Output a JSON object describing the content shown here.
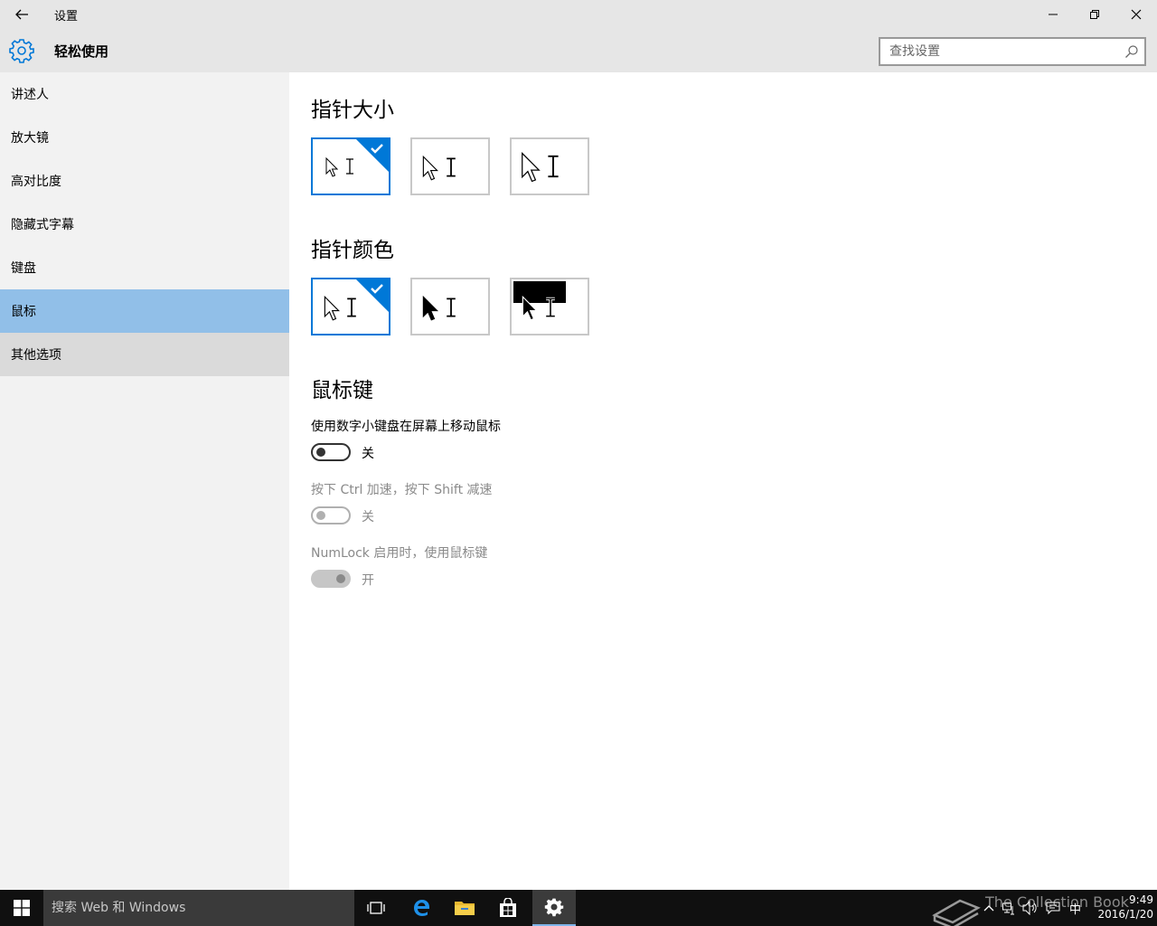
{
  "window": {
    "title": "设置"
  },
  "header": {
    "title": "轻松使用",
    "search_placeholder": "查找设置"
  },
  "sidebar": {
    "items": [
      {
        "label": "讲述人"
      },
      {
        "label": "放大镜"
      },
      {
        "label": "高对比度"
      },
      {
        "label": "隐藏式字幕"
      },
      {
        "label": "键盘"
      },
      {
        "label": "鼠标",
        "selected": true
      },
      {
        "label": "其他选项"
      }
    ]
  },
  "content": {
    "pointer_size": {
      "title": "指针大小",
      "selected_index": 0
    },
    "pointer_color": {
      "title": "指针颜色",
      "selected_index": 0
    },
    "mouse_keys": {
      "title": "鼠标键",
      "settings": [
        {
          "label": "使用数字小键盘在屏幕上移动鼠标",
          "state": "关",
          "on": false,
          "enabled": true
        },
        {
          "label": "按下 Ctrl 加速，按下 Shift 减速",
          "state": "关",
          "on": false,
          "enabled": false
        },
        {
          "label": "NumLock 启用时，使用鼠标键",
          "state": "开",
          "on": true,
          "enabled": false
        }
      ]
    }
  },
  "taskbar": {
    "search_placeholder": "搜索 Web 和 Windows",
    "watermark": "The Collection Book",
    "ime": "中",
    "time": "9:49",
    "date": "2016/1/20"
  },
  "colors": {
    "accent": "#0078d7",
    "nav_selected": "#91bfe8",
    "taskbar": "#101010"
  }
}
